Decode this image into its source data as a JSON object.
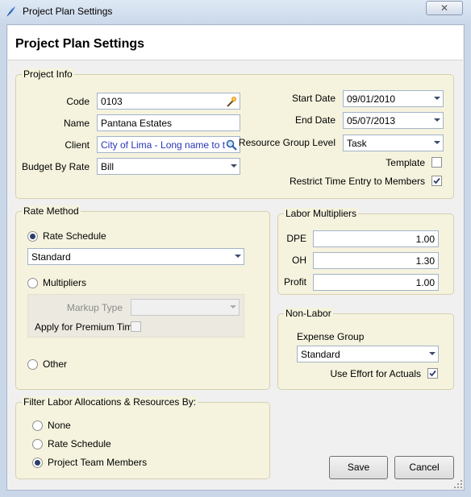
{
  "window": {
    "title": "Project Plan Settings",
    "close_glyph": "✕"
  },
  "header": {
    "title": "Project Plan Settings"
  },
  "project_info": {
    "legend": "Project Info",
    "code_label": "Code",
    "code_value": "0103",
    "name_label": "Name",
    "name_value": "Pantana Estates",
    "client_label": "Client",
    "client_value": "City of Lima - Long name to t",
    "budget_label": "Budget By Rate",
    "budget_value": "Bill",
    "start_label": "Start Date",
    "start_value": "09/01/2010",
    "end_label": "End Date",
    "end_value": "05/07/2013",
    "resgroup_label": "Resource Group Level",
    "resgroup_value": "Task",
    "template_label": "Template",
    "template_checked": false,
    "restrict_label": "Restrict Time Entry to Members",
    "restrict_checked": true
  },
  "rate_method": {
    "legend": "Rate Method",
    "rate_schedule_label": "Rate Schedule",
    "rate_schedule_value": "Standard",
    "multipliers_label": "Multipliers",
    "markup_label": "Markup Type",
    "markup_value": "",
    "premium_label": "Apply for Premium Time",
    "other_label": "Other",
    "selected": "Rate Schedule"
  },
  "labor_multipliers": {
    "legend": "Labor Multipliers",
    "dpe_label": "DPE",
    "dpe_value": "1.00",
    "oh_label": "OH",
    "oh_value": "1.30",
    "profit_label": "Profit",
    "profit_value": "1.00"
  },
  "non_labor": {
    "legend": "Non-Labor",
    "expense_label": "Expense Group",
    "expense_value": "Standard",
    "effort_label": "Use Effort for Actuals",
    "effort_checked": true
  },
  "filter": {
    "legend": "Filter Labor Allocations & Resources By:",
    "none_label": "None",
    "rate_schedule_label": "Rate Schedule",
    "team_label": "Project Team Members",
    "selected": "Project Team Members"
  },
  "buttons": {
    "save": "Save",
    "cancel": "Cancel"
  },
  "icons": {
    "app": "feather-icon",
    "code_lookup": "wand-icon",
    "client_lookup": "search-icon",
    "check": "checkmark-icon",
    "dropdown": "chevron-down-icon"
  },
  "colors": {
    "group_bg": "#f5f3de",
    "client_link": "#2b35b8",
    "title_bar": "#dfe9f5"
  }
}
